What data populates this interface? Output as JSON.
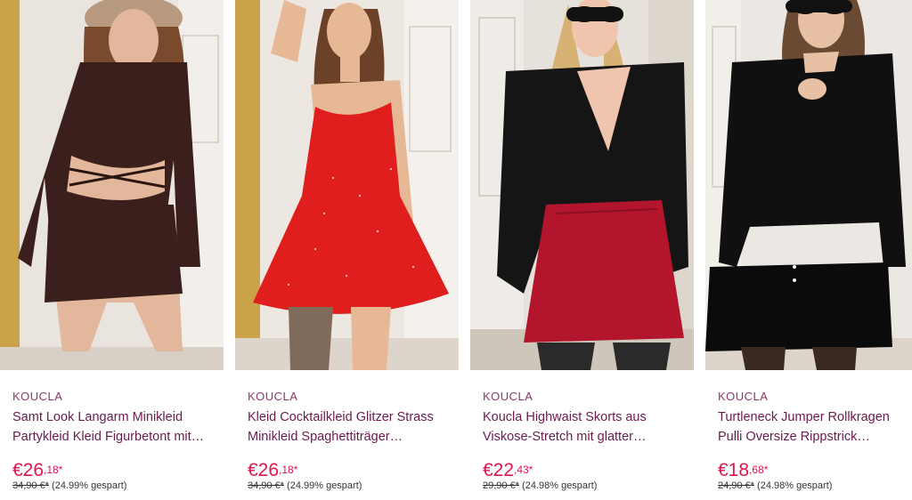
{
  "products": [
    {
      "brand": "KOUCLA",
      "title": "Samt Look Langarm Minikleid Partykleid Kleid Figurbetont mit…",
      "price_main": "€26",
      "price_cents": ",18*",
      "old_price": "34,90 €*",
      "discount": "(24.99% gespart)",
      "colors": {
        "bg": "#e9e4de",
        "garment": "#3a1f1c",
        "skin": "#e3b79b",
        "hair": "#7a4a2c"
      }
    },
    {
      "brand": "KOUCLA",
      "title": "Kleid Cocktailkleid Glitzer Strass Minikleid Spaghettiträger…",
      "price_main": "€26",
      "price_cents": ",18*",
      "old_price": "34,90 €*",
      "discount": "(24.99% gespart)",
      "colors": {
        "bg": "#ece7e1",
        "garment": "#e01e1e",
        "skin": "#e6b896",
        "hair": "#6b4128"
      }
    },
    {
      "brand": "KOUCLA",
      "title": "Koucla Highwaist Skorts aus Viskose-Stretch mit glatter…",
      "price_main": "€22",
      "price_cents": ",43*",
      "old_price": "29,90 €*",
      "discount": "(24.98% gespart)",
      "colors": {
        "bg": "#e6e1db",
        "garment": "#151515",
        "skirt": "#b3162c",
        "skin": "#efc6ad",
        "hair": "#d8b274"
      }
    },
    {
      "brand": "KOUCLA",
      "title": "Turtleneck Jumper Rollkragen Pulli Oversize Rippstrick Pullover…",
      "price_main": "€18",
      "price_cents": ",68*",
      "old_price": "24,90 €*",
      "discount": "(24.98% gespart)",
      "colors": {
        "bg": "#ebe7e2",
        "garment": "#101010",
        "skin": "#e8c0a4",
        "hair": "#6b4a33"
      }
    }
  ]
}
